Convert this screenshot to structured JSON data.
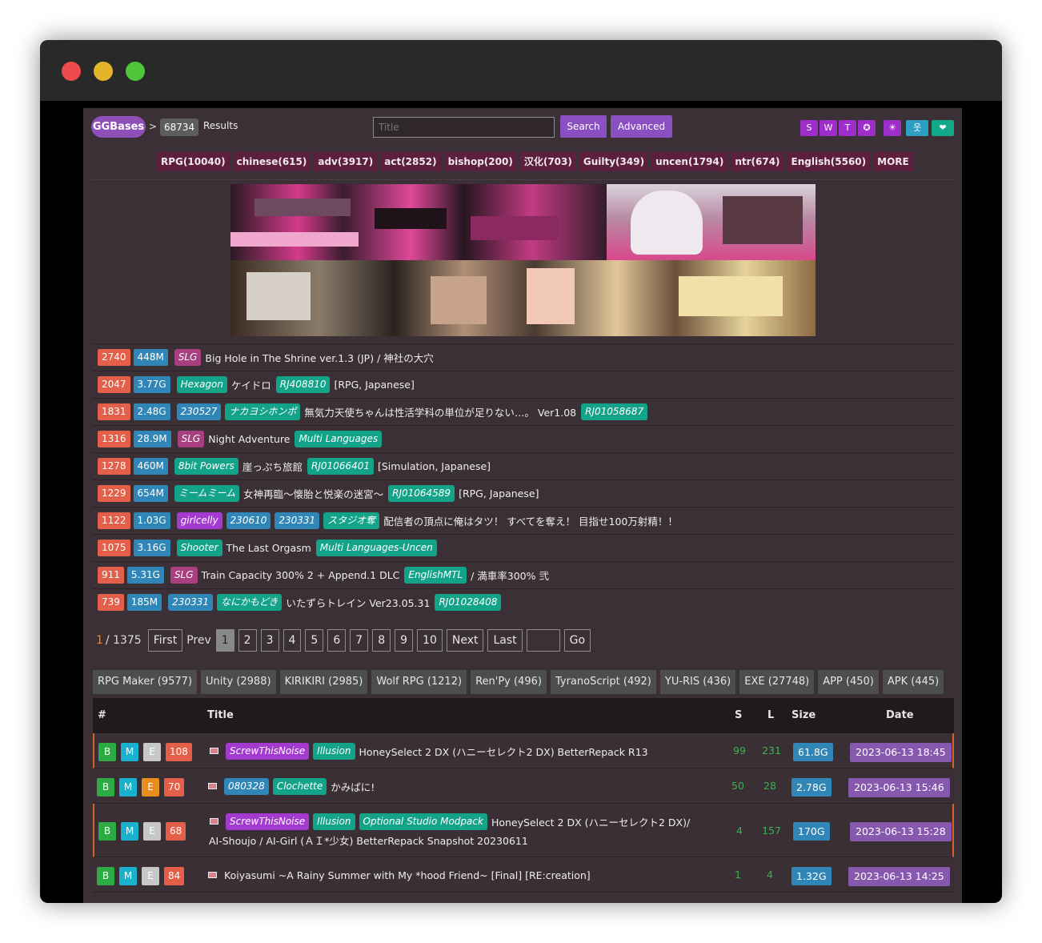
{
  "header": {
    "logo": "GGBases",
    "separator": ">",
    "results_count": "68734",
    "results_label": "Results",
    "search_placeholder": "Title",
    "search_button": "Search",
    "advanced_button": "Advanced",
    "icon_buttons": [
      {
        "label": "S",
        "color": "#9d2ec9"
      },
      {
        "label": "W",
        "color": "#9d2ec9"
      },
      {
        "label": "T",
        "color": "#9d2ec9"
      },
      {
        "label": "✪",
        "color": "#9d2ec9"
      },
      {
        "label": "☀",
        "color": "#9d2ec9"
      },
      {
        "label": "웃",
        "color": "#2e9fc2"
      },
      {
        "label": "❤",
        "color": "#12a889"
      }
    ]
  },
  "tags": [
    "RPG(10040)",
    "chinese(615)",
    "adv(3917)",
    "act(2852)",
    "bishop(200)",
    "汉化(703)",
    "Guilty(349)",
    "uncen(1794)",
    "ntr(674)",
    "English(5560)",
    "MORE"
  ],
  "featured": [
    {
      "count": "2740",
      "size": "448M",
      "segs": [
        {
          "t": "tag",
          "c": "tp",
          "v": "SLG"
        },
        {
          "t": "txt",
          "v": "Big Hole in The Shrine ver.1.3 (JP) / 神社の大穴"
        }
      ]
    },
    {
      "count": "2047",
      "size": "3.77G",
      "segs": [
        {
          "t": "tag",
          "c": "tt",
          "v": "Hexagon"
        },
        {
          "t": "txt",
          "v": "ケイドロ"
        },
        {
          "t": "tag",
          "c": "tt",
          "v": "RJ408810"
        },
        {
          "t": "txt",
          "v": "[RPG, Japanese]"
        }
      ]
    },
    {
      "count": "1831",
      "size": "2.48G",
      "segs": [
        {
          "t": "tag",
          "c": "tb",
          "v": "230527"
        },
        {
          "t": "tag",
          "c": "tt",
          "v": "ナカヨシホンポ"
        },
        {
          "t": "txt",
          "v": "無気力天使ちゃんは性活学科の単位が足りない…。 Ver1.08"
        },
        {
          "t": "tag",
          "c": "tt",
          "v": "RJ01058687"
        }
      ]
    },
    {
      "count": "1316",
      "size": "28.9M",
      "segs": [
        {
          "t": "tag",
          "c": "tp",
          "v": "SLG"
        },
        {
          "t": "txt",
          "v": "Night Adventure"
        },
        {
          "t": "tag",
          "c": "tt",
          "v": "Multi Languages"
        }
      ]
    },
    {
      "count": "1278",
      "size": "460M",
      "segs": [
        {
          "t": "tag",
          "c": "tt",
          "v": "8bit Powers"
        },
        {
          "t": "txt",
          "v": "崖っぷち旅館"
        },
        {
          "t": "tag",
          "c": "tt",
          "v": "RJ01066401"
        },
        {
          "t": "txt",
          "v": "[Simulation, Japanese]"
        }
      ]
    },
    {
      "count": "1229",
      "size": "654M",
      "segs": [
        {
          "t": "tag",
          "c": "tt",
          "v": "ミームミーム"
        },
        {
          "t": "txt",
          "v": "女神再臨～懐胎と悦楽の迷宮～"
        },
        {
          "t": "tag",
          "c": "tt",
          "v": "RJ01064589"
        },
        {
          "t": "txt",
          "v": "[RPG, Japanese]"
        }
      ]
    },
    {
      "count": "1122",
      "size": "1.03G",
      "segs": [
        {
          "t": "tag",
          "c": "tv",
          "v": "girlcelly"
        },
        {
          "t": "tag",
          "c": "tb",
          "v": "230610"
        },
        {
          "t": "tag",
          "c": "tb",
          "v": "230331"
        },
        {
          "t": "tag",
          "c": "tt",
          "v": "スタジオ奪"
        },
        {
          "t": "txt",
          "v": "配信者の頂点に俺はタツ！ すべてを奪え！ 目指せ100万射精！！"
        }
      ]
    },
    {
      "count": "1075",
      "size": "3.16G",
      "segs": [
        {
          "t": "tag",
          "c": "tt",
          "v": "Shooter"
        },
        {
          "t": "txt",
          "v": "The Last Orgasm"
        },
        {
          "t": "tag",
          "c": "tt",
          "v": "Multi Languages-Uncen"
        }
      ]
    },
    {
      "count": "911",
      "size": "5.31G",
      "segs": [
        {
          "t": "tag",
          "c": "tp",
          "v": "SLG"
        },
        {
          "t": "txt",
          "v": "Train Capacity 300% 2 + Append.1 DLC"
        },
        {
          "t": "tag",
          "c": "tt",
          "v": "EnglishMTL"
        },
        {
          "t": "txt",
          "v": "/ 満車率300% 弐"
        }
      ]
    },
    {
      "count": "739",
      "size": "185M",
      "segs": [
        {
          "t": "tag",
          "c": "tb",
          "v": "230331"
        },
        {
          "t": "tag",
          "c": "tt",
          "v": "なにかもどき"
        },
        {
          "t": "txt",
          "v": "いたずらトレイン Ver23.05.31"
        },
        {
          "t": "tag",
          "c": "tt",
          "v": "RJ01028408"
        }
      ]
    }
  ],
  "pagination": {
    "current": "1",
    "total": "/ 1375",
    "first": "First",
    "prev": "Prev",
    "pages": [
      "1",
      "2",
      "3",
      "4",
      "5",
      "6",
      "7",
      "8",
      "9",
      "10"
    ],
    "next": "Next",
    "last": "Last",
    "go": "Go"
  },
  "engines": [
    "RPG Maker (9577)",
    "Unity (2988)",
    "KIRIKIRI (2985)",
    "Wolf RPG (1212)",
    "Ren'Py (496)",
    "TyranoScript (492)",
    "YU-RIS (436)",
    "EXE (27748)",
    "APP (450)",
    "APK (445)"
  ],
  "table": {
    "headers": {
      "num": "#",
      "title": "Title",
      "s": "S",
      "l": "L",
      "size": "Size",
      "date": "Date"
    },
    "rows": [
      {
        "b": "B",
        "m": "M",
        "e": "E",
        "count": "108",
        "tags": [
          {
            "c": "tv",
            "v": "ScrewThisNoise"
          },
          {
            "c": "tt",
            "v": "Illusion"
          }
        ],
        "title": "HoneySelect 2 DX (ハニーセレクト2 DX) BetterRepack R13",
        "title2": "",
        "s": "99",
        "l": "231",
        "size": "61.8G",
        "date": "2023-06-13 18:45"
      },
      {
        "b": "B",
        "m": "M",
        "e": "E",
        "count": "70",
        "tags": [
          {
            "c": "tb",
            "v": "080328"
          },
          {
            "c": "tt",
            "v": "Clochette"
          }
        ],
        "title": "かみぱに!",
        "title2": "",
        "s": "50",
        "l": "28",
        "size": "2.78G",
        "date": "2023-06-13 15:46"
      },
      {
        "b": "B",
        "m": "M",
        "e": "E",
        "count": "68",
        "tags": [
          {
            "c": "tv",
            "v": "ScrewThisNoise"
          },
          {
            "c": "tt",
            "v": "Illusion"
          },
          {
            "c": "tt",
            "v": "Optional Studio Modpack"
          }
        ],
        "title": "HoneySelect 2 DX (ハニーセレクト2 DX)/",
        "title2": "AI-Shoujo / AI-Girl (ＡＩ*少女) BetterRepack Snapshot 20230611",
        "s": "4",
        "l": "157",
        "size": "170G",
        "date": "2023-06-13 15:28"
      },
      {
        "b": "B",
        "m": "M",
        "e": "E",
        "count": "84",
        "tags": [],
        "title": "Koiyasumi ~A Rainy Summer with My *hood Friend~ [Final] [RE:creation]",
        "title2": "",
        "s": "1",
        "l": "4",
        "size": "1.32G",
        "date": "2023-06-13 14:25"
      }
    ]
  }
}
